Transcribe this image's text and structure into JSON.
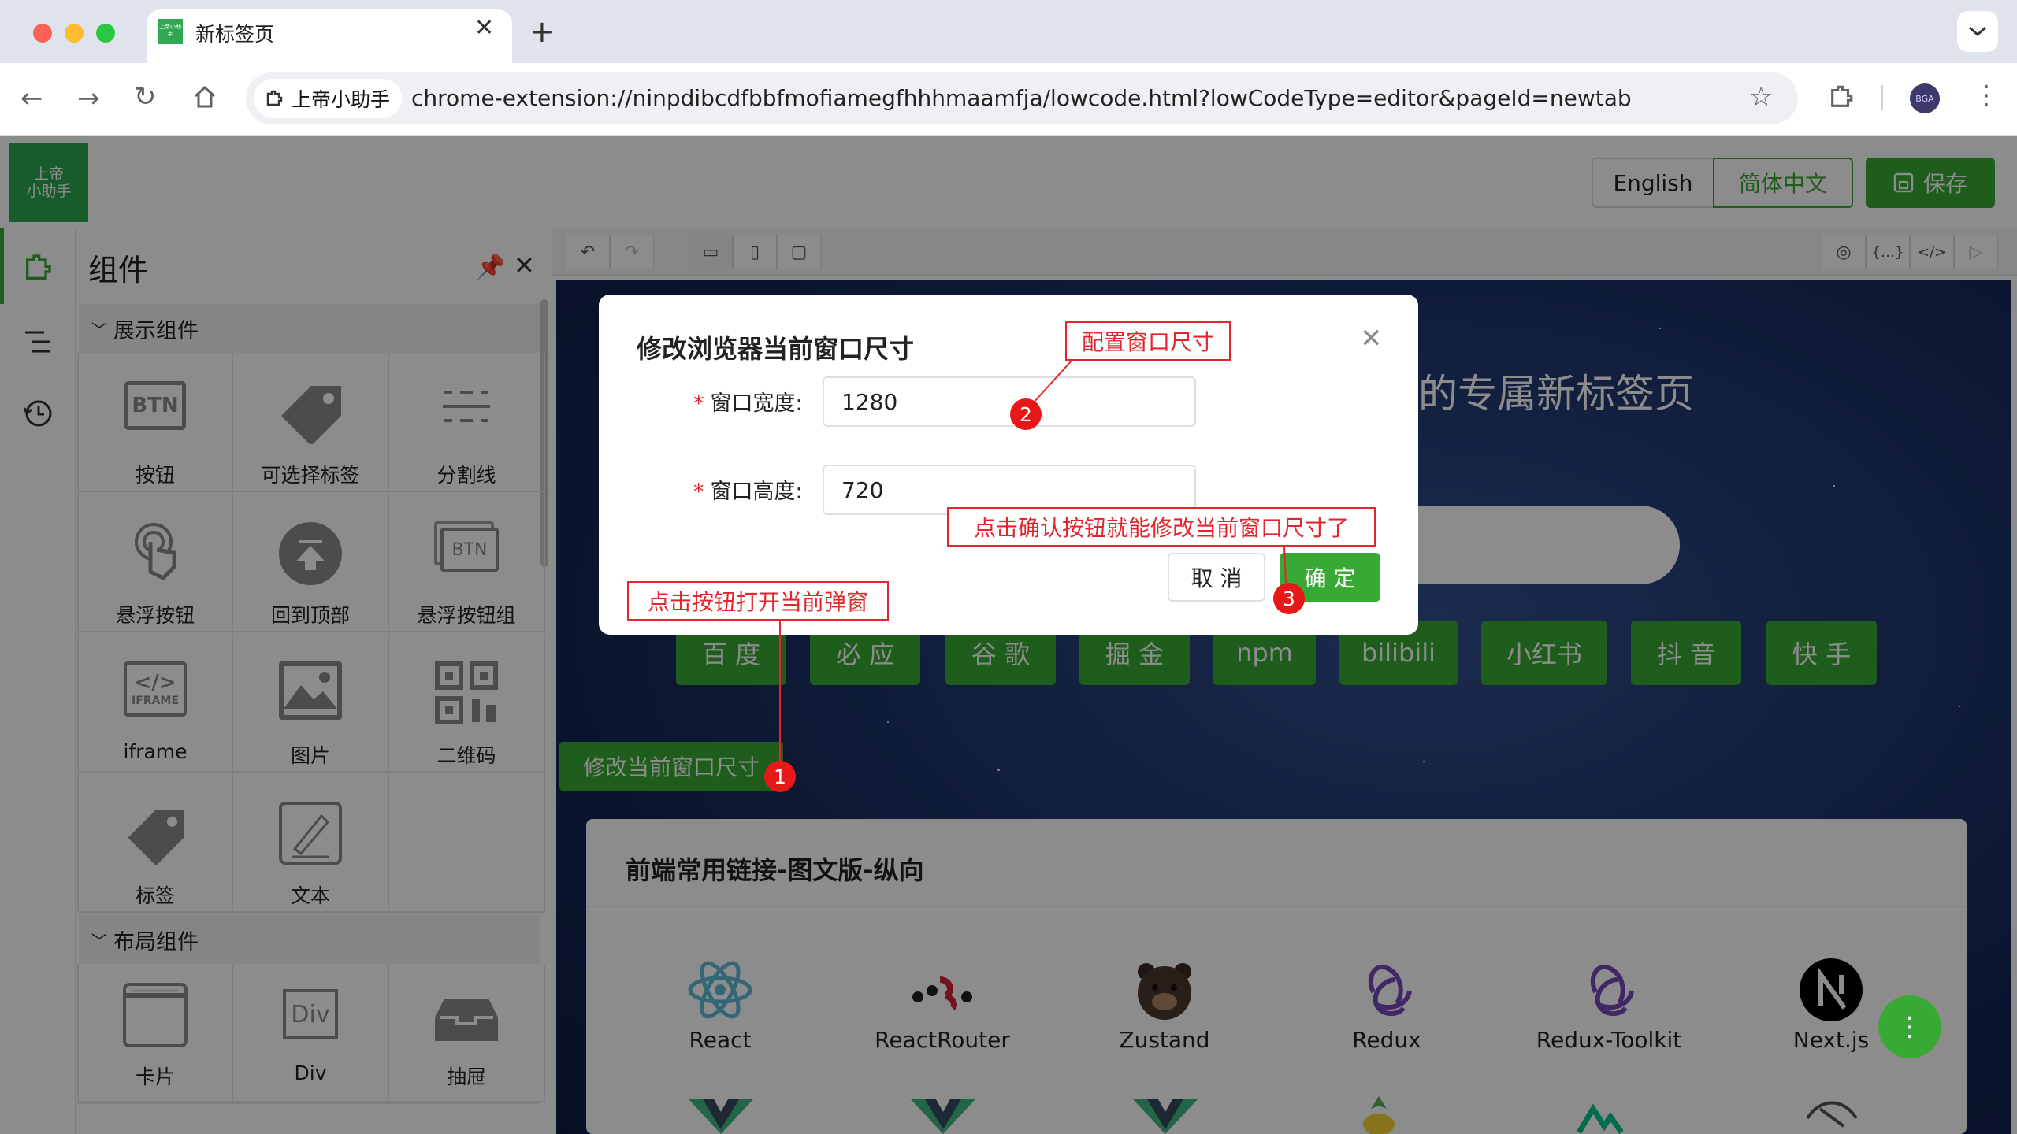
{
  "browser": {
    "tab_title": "新标签页",
    "tab_favicon_text": "上帝小助手",
    "site_chip": "上帝小助手",
    "url": "chrome-extension://ninpdibcdfbbfmofiamegfhhhmaamfja/lowcode.html?lowCodeType=editor&pageId=newtab",
    "profile_initials": "BGA"
  },
  "app": {
    "logo_line1": "上帝",
    "logo_line2": "小助手",
    "lang_en": "English",
    "lang_zh": "简体中文",
    "save": "保存"
  },
  "panel": {
    "title": "组件",
    "section_display": "展示组件",
    "section_layout": "布局组件",
    "display_items": [
      {
        "label": "按钮",
        "icon": "btn-icon"
      },
      {
        "label": "可选择标签",
        "icon": "tag-icon"
      },
      {
        "label": "分割线",
        "icon": "divider-icon"
      },
      {
        "label": "悬浮按钮",
        "icon": "touch-icon"
      },
      {
        "label": "回到顶部",
        "icon": "back-top-icon"
      },
      {
        "label": "悬浮按钮组",
        "icon": "btn-group-icon"
      },
      {
        "label": "iframe",
        "icon": "iframe-icon"
      },
      {
        "label": "图片",
        "icon": "image-icon"
      },
      {
        "label": "二维码",
        "icon": "qrcode-icon"
      },
      {
        "label": "标签",
        "icon": "label-icon"
      },
      {
        "label": "文本",
        "icon": "text-icon"
      }
    ],
    "layout_items": [
      {
        "label": "卡片",
        "icon": "card-icon"
      },
      {
        "label": "Div",
        "icon": "div-icon"
      },
      {
        "label": "抽屉",
        "icon": "drawer-icon"
      }
    ],
    "btn_icon_text": "BTN",
    "iframe_icon_text": "IFRAME",
    "div_icon_text": "Div"
  },
  "stage": {
    "heading_fragment": "的专属新标签页",
    "quick_links": [
      "百 度",
      "必 应",
      "谷 歌",
      "掘 金",
      "npm",
      "bilibili",
      "小红书",
      "抖 音",
      "快 手"
    ],
    "resize_button": "修改当前窗口尺寸",
    "card_title": "前端常用链接-图文版-纵向",
    "links": [
      "React",
      "ReactRouter",
      "Zustand",
      "Redux",
      "Redux-Toolkit",
      "Next.js"
    ],
    "fab_icon": "more-vertical-icon"
  },
  "modal": {
    "title": "修改浏览器当前窗口尺寸",
    "width_label": "窗口宽度:",
    "width_value": "1280",
    "height_label": "窗口高度:",
    "height_value": "720",
    "required_mark": "*",
    "cancel": "取 消",
    "ok": "确 定"
  },
  "annotations": {
    "configure": "配置窗口尺寸",
    "confirm_hint": "点击确认按钮就能修改当前窗口尺寸了",
    "open_hint": "点击按钮打开当前弹窗",
    "n1": "1",
    "n2": "2",
    "n3": "3"
  },
  "colors": {
    "brand_green": "#39a935",
    "annotation_red": "#e3262d"
  }
}
